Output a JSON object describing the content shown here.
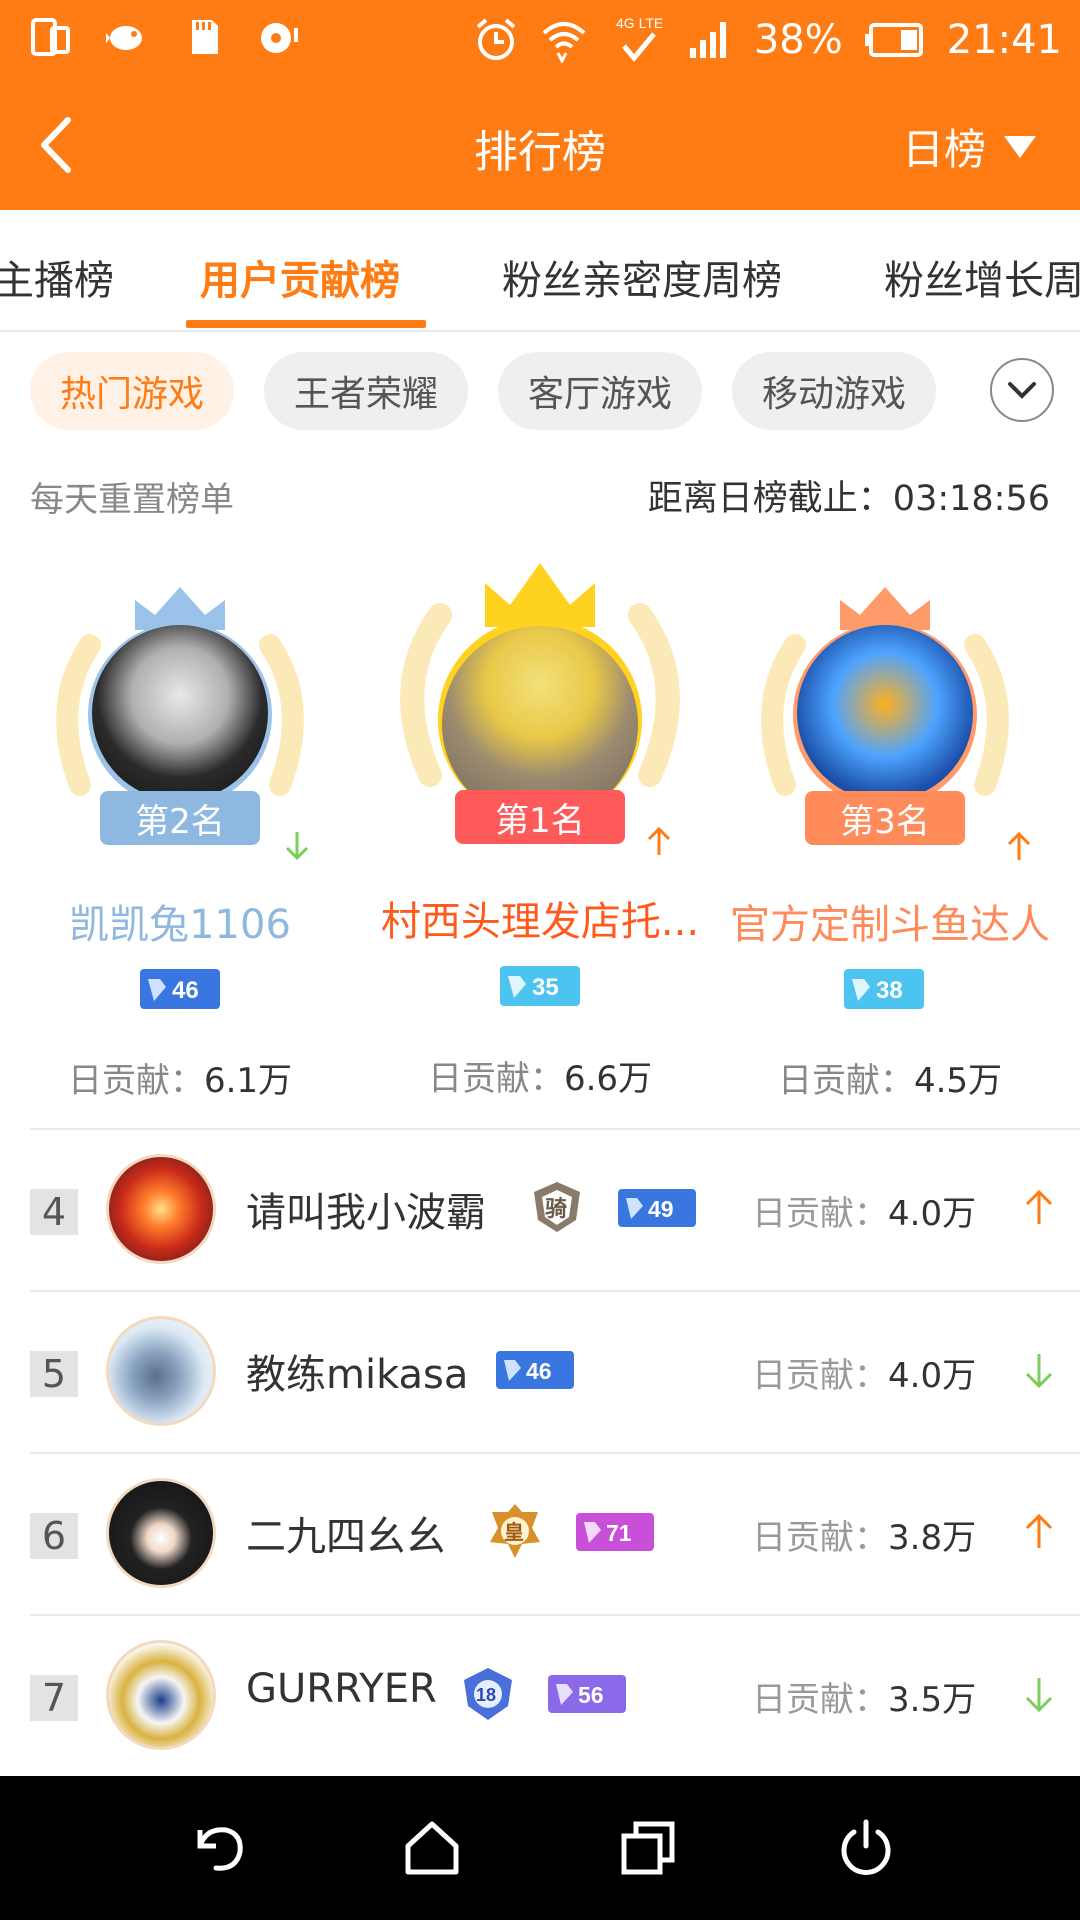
{
  "status_bar": {
    "battery": "38%",
    "time": "21:41",
    "network": "4G LTE"
  },
  "header": {
    "title": "排行榜",
    "period": "日榜"
  },
  "tabs": [
    {
      "label": "主播榜"
    },
    {
      "label": "用户贡献榜",
      "active": true
    },
    {
      "label": "粉丝亲密度周榜"
    },
    {
      "label": "粉丝增长周"
    }
  ],
  "chips": [
    {
      "label": "热门游戏",
      "active": true
    },
    {
      "label": "王者荣耀"
    },
    {
      "label": "客厅游戏"
    },
    {
      "label": "移动游戏"
    }
  ],
  "info": {
    "reset_note": "每天重置榜单",
    "countdown_label": "距离日榜截止：",
    "countdown_value": "03:18:56"
  },
  "top3": [
    {
      "rank_label": "第2名",
      "name": "凯凯兔1106",
      "level": "46",
      "contrib_label": "日贡献：",
      "contrib_value": "6.1万",
      "trend": "down",
      "color": "#8fb8e0"
    },
    {
      "rank_label": "第1名",
      "name": "村西头理发店托...",
      "level": "35",
      "contrib_label": "日贡献：",
      "contrib_value": "6.6万",
      "trend": "up",
      "color": "#ff5a5a"
    },
    {
      "rank_label": "第3名",
      "name": "官方定制斗鱼达人",
      "level": "38",
      "contrib_label": "日贡献：",
      "contrib_value": "4.5万",
      "trend": "up",
      "color": "#ff8a5a"
    }
  ],
  "rows": [
    {
      "rank": "4",
      "name": "请叫我小波霸",
      "medal": "骑",
      "level": "49",
      "contrib_label": "日贡献：",
      "contrib_value": "4.0万",
      "trend": "up"
    },
    {
      "rank": "5",
      "name": "教练mikasa",
      "level": "46",
      "contrib_label": "日贡献：",
      "contrib_value": "4.0万",
      "trend": "down"
    },
    {
      "rank": "6",
      "name": "二九四幺幺",
      "medal": "皇",
      "level": "71",
      "contrib_label": "日贡献：",
      "contrib_value": "3.8万",
      "trend": "up"
    },
    {
      "rank": "7",
      "name": "GURRYER",
      "medal": "18",
      "level": "56",
      "contrib_label": "日贡献：",
      "contrib_value": "3.5万",
      "trend": "down"
    }
  ],
  "colors": {
    "accent": "#ff7b14",
    "up": "#ff7b14",
    "down": "#7ccd5a"
  }
}
